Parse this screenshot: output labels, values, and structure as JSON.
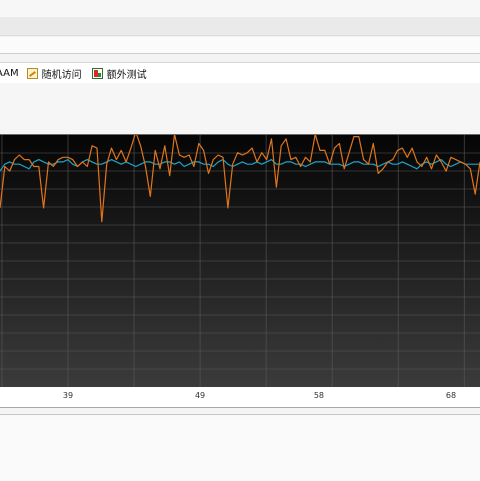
{
  "toolbar": {
    "tabs": [
      {
        "label": "AAM",
        "icon": ""
      },
      {
        "label": "随机访问",
        "icon": "random-access-icon"
      },
      {
        "label": "额外测试",
        "icon": "extra-tests-icon"
      }
    ]
  },
  "chart_data": {
    "type": "line",
    "background": "#101010",
    "grid": true,
    "x_ticks": [
      39,
      49,
      58,
      68
    ],
    "ylim": [
      0,
      100
    ],
    "series": [
      {
        "color": "#1fa3c8",
        "values": [
          93,
          96,
          97,
          96,
          96,
          95,
          94,
          97,
          98,
          97,
          96,
          96,
          97,
          97,
          98,
          96,
          95,
          97,
          98,
          97,
          96,
          96,
          97,
          98,
          97,
          96,
          97,
          96,
          95,
          96,
          97,
          97,
          96,
          96,
          97,
          97,
          96,
          97,
          95,
          96,
          97,
          97,
          96,
          96,
          95,
          97,
          98,
          96,
          95,
          96,
          97,
          96,
          96,
          97,
          96,
          97,
          98,
          96,
          96,
          97,
          97,
          96,
          96,
          95,
          96,
          97,
          97,
          97,
          96,
          96,
          96,
          95,
          96,
          97,
          97,
          96,
          96,
          96,
          95,
          96,
          97,
          96,
          96,
          97,
          96,
          95,
          94,
          96,
          97,
          96,
          97,
          98,
          96,
          95,
          96,
          97,
          96,
          96,
          96,
          96
        ]
      },
      {
        "color": "#e0751c",
        "values": [
          77,
          95,
          93,
          98,
          100,
          98,
          98,
          95,
          95,
          77,
          97,
          95,
          98,
          99,
          99,
          98,
          95,
          97,
          95,
          104,
          103,
          71,
          96,
          103,
          98,
          102,
          97,
          103,
          110,
          104,
          95,
          82,
          102,
          94,
          104,
          91,
          109,
          100,
          99,
          100,
          95,
          105,
          102,
          92,
          98,
          100,
          99,
          77,
          96,
          101,
          100,
          101,
          103,
          97,
          101,
          98,
          107,
          86,
          104,
          107,
          98,
          99,
          95,
          99,
          97,
          109,
          102,
          102,
          96,
          103,
          105,
          94,
          101,
          108,
          108,
          98,
          96,
          105,
          92,
          94,
          97,
          98,
          102,
          103,
          99,
          103,
          97,
          95,
          99,
          94,
          100,
          97,
          93,
          99,
          98,
          97,
          96,
          94,
          83,
          97
        ]
      }
    ]
  }
}
